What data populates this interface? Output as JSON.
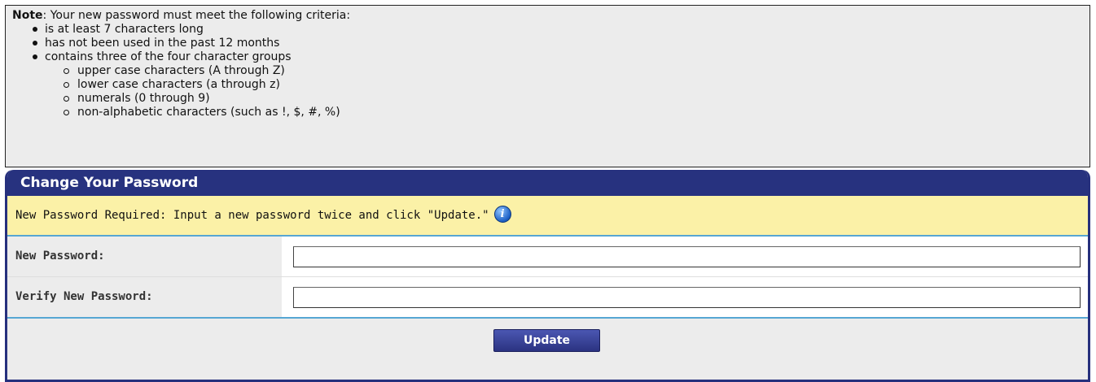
{
  "note": {
    "prefix": "Note",
    "intro": ": Your new password must meet the following criteria:",
    "criteria": [
      "is at least 7 characters long",
      "has not been used in the past 12 months",
      "contains three of the four character groups"
    ],
    "groups": [
      "upper case characters (A through Z)",
      "lower case characters (a through z)",
      "numerals (0 through 9)",
      "non-alphabetic characters (such as !, $, #, %)"
    ]
  },
  "panel": {
    "title": "Change Your Password",
    "notice": "New Password Required: Input a new password twice and click \"Update.\"",
    "info_icon": "info-icon",
    "fields": {
      "new_password": {
        "label": "New Password:",
        "value": ""
      },
      "verify_password": {
        "label": "Verify New Password:",
        "value": ""
      }
    },
    "update_label": "Update"
  },
  "colors": {
    "header": "#27327f",
    "notice_bg": "#fbf1a7",
    "separator": "#56a6d3",
    "panel_bg": "#ececec"
  }
}
